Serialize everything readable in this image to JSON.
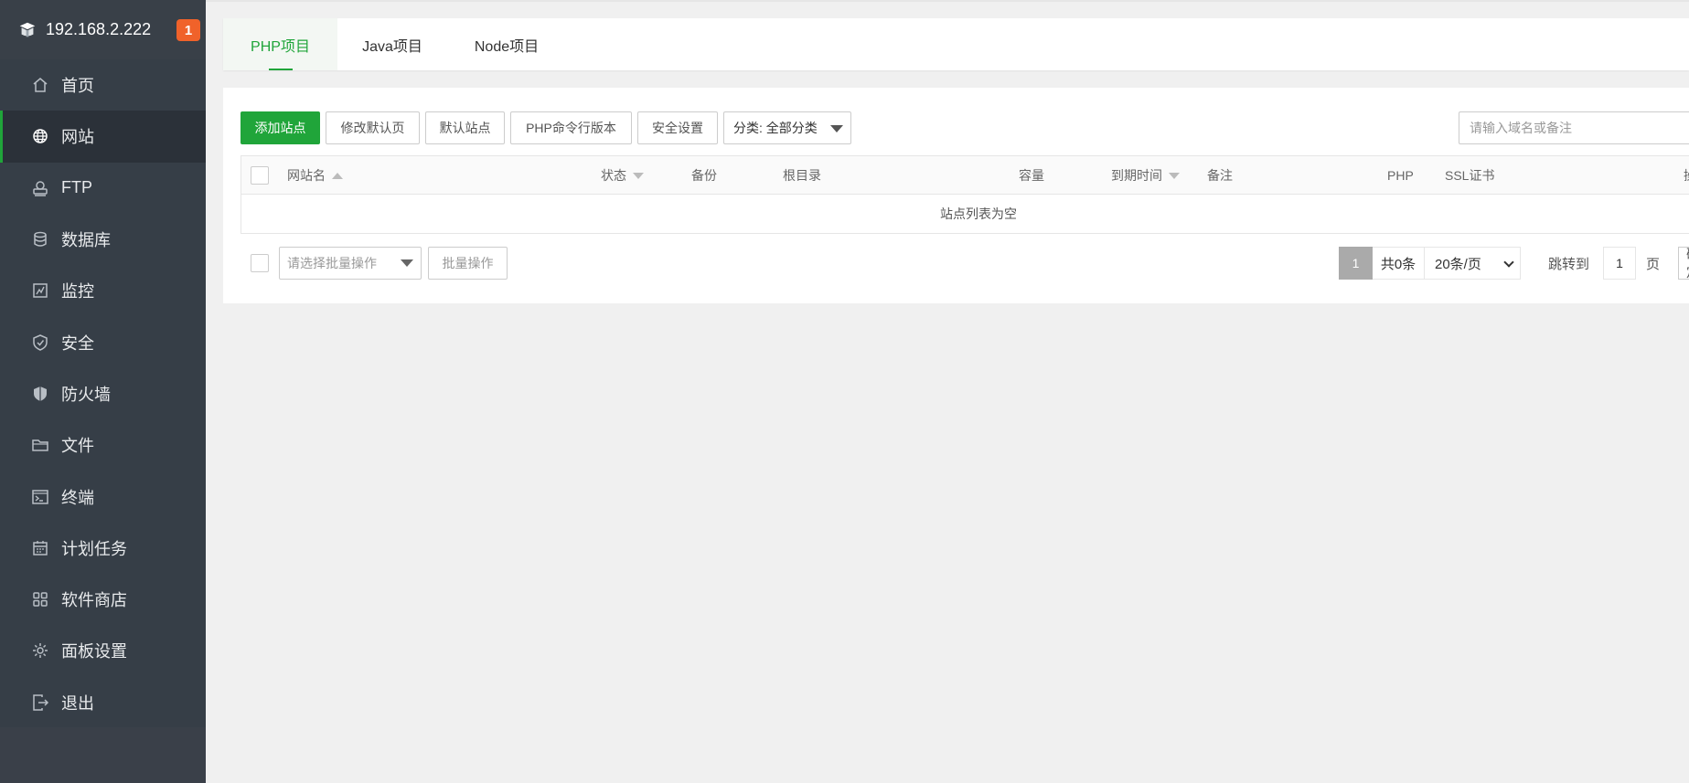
{
  "sidebar": {
    "server_ip": "192.168.2.222",
    "notification_count": "1",
    "items": [
      {
        "label": "首页",
        "icon": "home-icon"
      },
      {
        "label": "网站",
        "icon": "globe-icon",
        "active": true
      },
      {
        "label": "FTP",
        "icon": "ftp-icon"
      },
      {
        "label": "数据库",
        "icon": "database-icon"
      },
      {
        "label": "监控",
        "icon": "monitor-icon"
      },
      {
        "label": "安全",
        "icon": "shield-check-icon"
      },
      {
        "label": "防火墙",
        "icon": "firewall-shield-icon"
      },
      {
        "label": "文件",
        "icon": "folder-icon"
      },
      {
        "label": "终端",
        "icon": "terminal-icon"
      },
      {
        "label": "计划任务",
        "icon": "calendar-icon"
      },
      {
        "label": "软件商店",
        "icon": "apps-grid-icon"
      },
      {
        "label": "面板设置",
        "icon": "gear-icon"
      },
      {
        "label": "退出",
        "icon": "logout-icon"
      }
    ]
  },
  "tabs": [
    {
      "label": "PHP项目",
      "active": true
    },
    {
      "label": "Java项目"
    },
    {
      "label": "Node项目"
    }
  ],
  "toolbar": {
    "add_site": "添加站点",
    "modify_default_page": "修改默认页",
    "default_site": "默认站点",
    "php_cli_version": "PHP命令行版本",
    "security_settings": "安全设置",
    "category_select": "分类: 全部分类",
    "search_placeholder": "请输入域名或备注"
  },
  "table": {
    "columns": [
      "网站名",
      "状态",
      "备份",
      "根目录",
      "容量",
      "到期时间",
      "备注",
      "PHP",
      "SSL证书",
      "操"
    ],
    "empty_message": "站点列表为空"
  },
  "footer": {
    "batch_select_placeholder": "请选择批量操作",
    "batch_button": "批量操作",
    "current_page": "1",
    "total": "共0条",
    "page_size": "20条/页",
    "jump_to": "跳转到",
    "jump_value": "1",
    "page_suffix": "页",
    "confirm": "确定"
  },
  "colors": {
    "accent": "#20a53a",
    "sidebar_bg": "#363e47",
    "sidebar_active_bg": "#2b3139",
    "badge": "#f0622a",
    "page_bg": "#f0f0f0"
  }
}
